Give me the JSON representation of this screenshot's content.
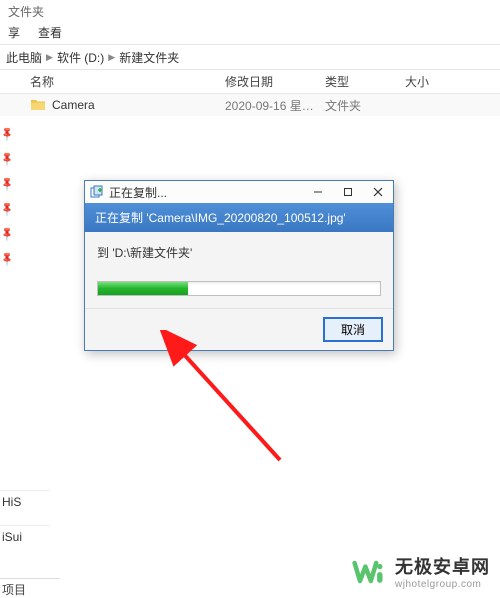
{
  "window": {
    "title_suffix": "文件夹"
  },
  "menu": {
    "share": "享",
    "view": "查看"
  },
  "breadcrumb": {
    "a": "此电脑",
    "b": "软件 (D:)",
    "c": "新建文件夹"
  },
  "columns": {
    "name": "名称",
    "date": "修改日期",
    "type": "类型",
    "size": "大小"
  },
  "rows": [
    {
      "name": "Camera",
      "date": "2020-09-16 星期…",
      "type": "文件夹"
    }
  ],
  "sidebar_bottom": {
    "item1": "HiS",
    "item2": "iSui",
    "footer": "项目"
  },
  "dialog": {
    "title": "正在复制...",
    "banner": "正在复制 'Camera\\IMG_20200820_100512.jpg'",
    "destination": "到 'D:\\新建文件夹'",
    "cancel": "取消",
    "progress_pct": 32
  },
  "watermark": {
    "name": "无极安卓网",
    "url": "wjhotelgroup.com"
  },
  "icons": {
    "folder": "folder-icon",
    "chevron": "chevron-right-icon",
    "pin": "pin-icon",
    "copy": "copy-icon",
    "minimize": "minimize-icon",
    "maximize": "maximize-icon",
    "close": "close-icon",
    "logo": "wuji-logo"
  }
}
